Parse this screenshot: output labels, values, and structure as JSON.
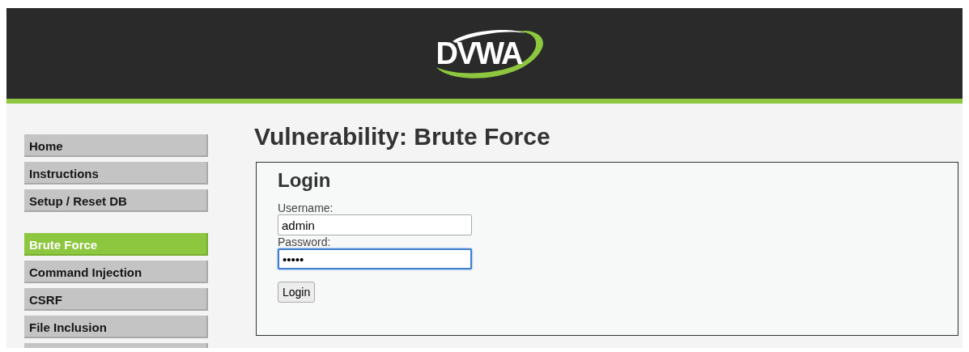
{
  "header": {
    "logo_text": "DVWA"
  },
  "sidebar": {
    "groups": [
      [
        {
          "label": "Home",
          "selected": false
        },
        {
          "label": "Instructions",
          "selected": false
        },
        {
          "label": "Setup / Reset DB",
          "selected": false
        }
      ],
      [
        {
          "label": "Brute Force",
          "selected": true
        },
        {
          "label": "Command Injection",
          "selected": false
        },
        {
          "label": "CSRF",
          "selected": false
        },
        {
          "label": "File Inclusion",
          "selected": false
        },
        {
          "selected": false
        }
      ]
    ]
  },
  "main": {
    "title": "Vulnerability: Brute Force",
    "login": {
      "heading": "Login",
      "fields": [
        {
          "label": "Username:",
          "value": "admin",
          "focused": false
        },
        {
          "label": "Password:",
          "value": "•••••",
          "focused": true
        }
      ],
      "button": "Login"
    }
  }
}
